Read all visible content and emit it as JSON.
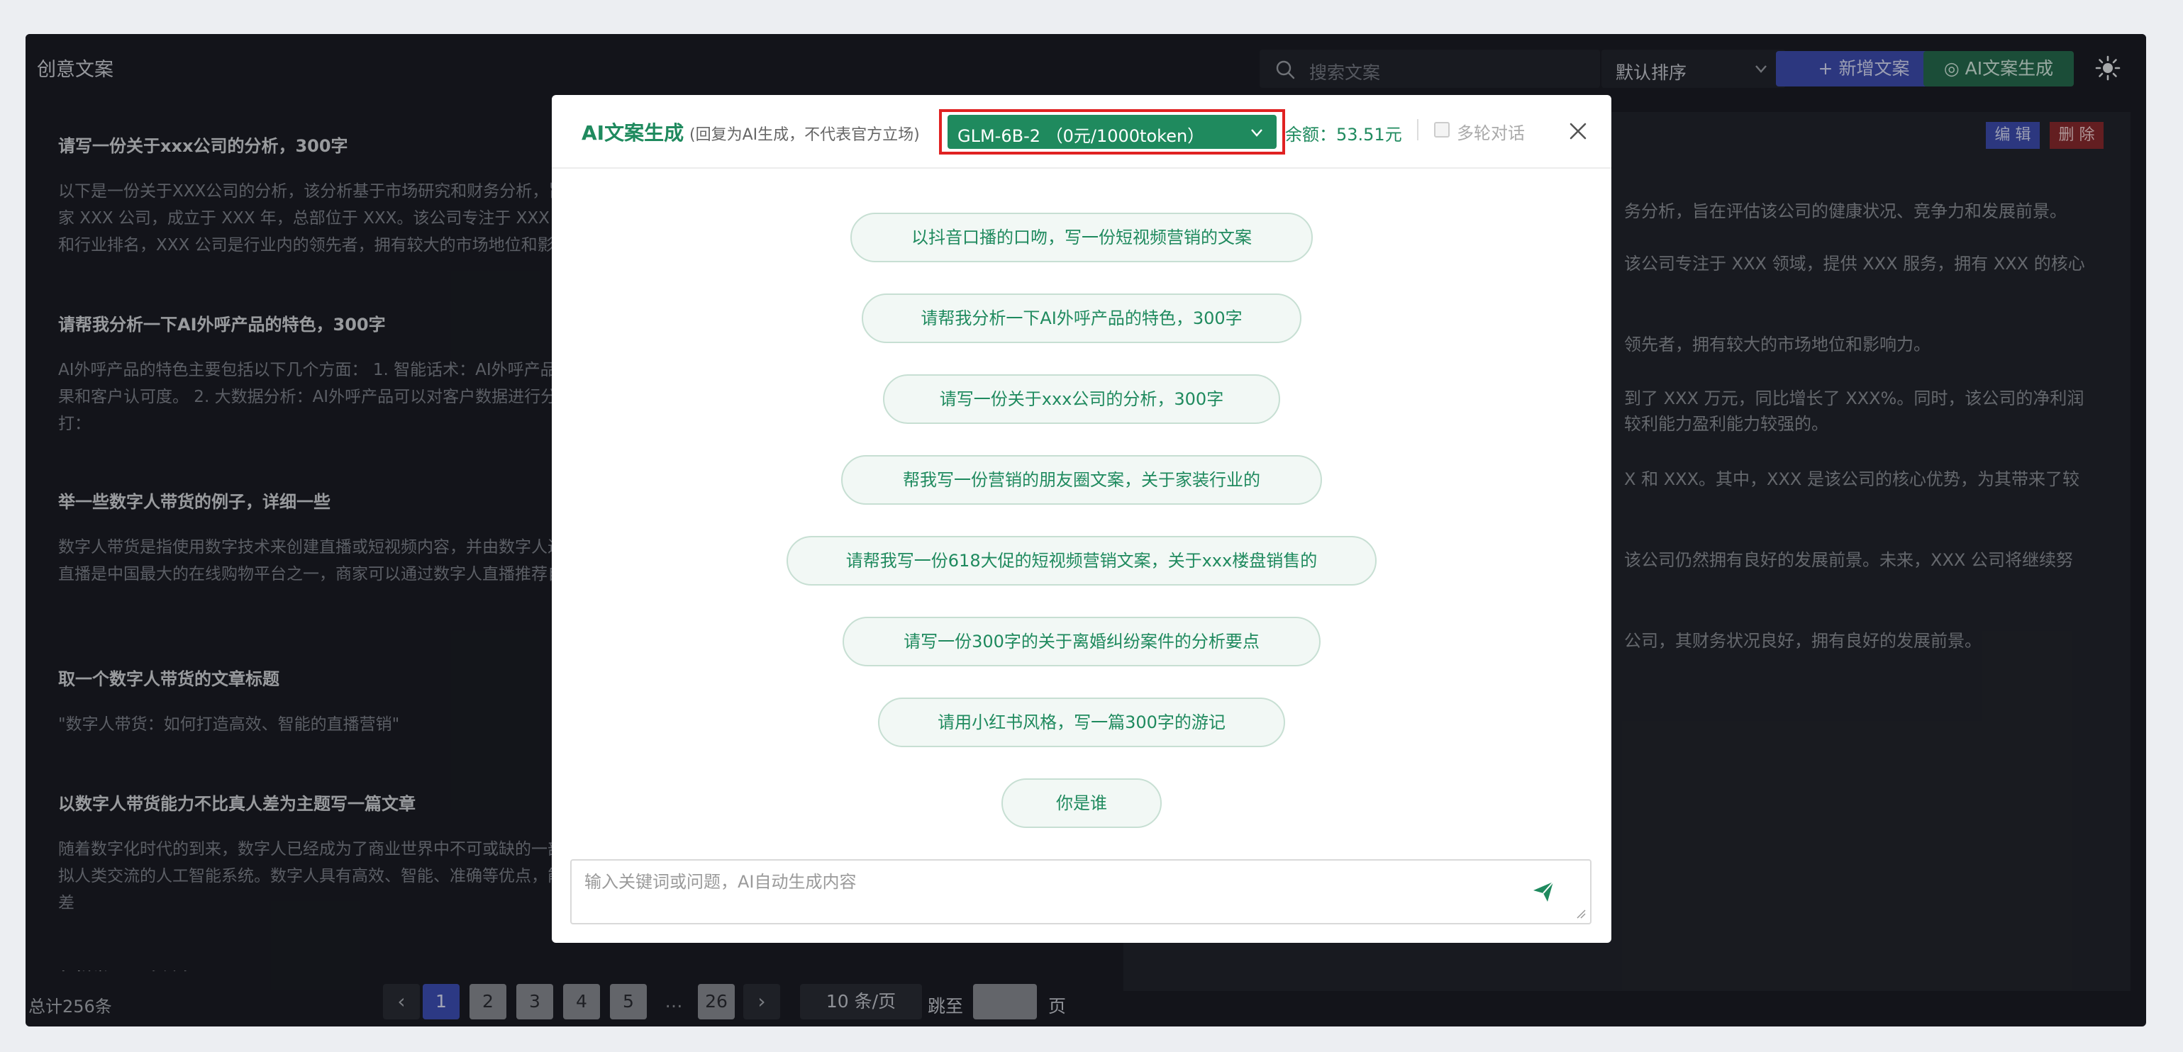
{
  "header": {
    "title": "创意文案",
    "search_placeholder": "搜索文案",
    "sort_label": "默认排序",
    "new_button": "+ 新增文案",
    "ai_button": "◎ AI文案生成"
  },
  "list": {
    "items": [
      {
        "title": "请写一份关于xxx公司的分析，300字",
        "desc": "以下是一份关于XXX公司的分析，该分析基于市场研究和财务分析，旨在评估该公司的健康状况、竞争力和发展前景。公司概况：XXX 公司是一家 XXX 公司，成立于 XXX 年，总部位于 XXX。该公司专注于 XXX 领域，提供 XXX 服务，拥有 XXX 的核心竞争力。 市场地位：根据市场份额和行业排名，XXX 公司是行业内的领先者，拥有较大的市场地位和影响力。"
      },
      {
        "title": "请帮我分析一下AI外呼产品的特色，300字",
        "desc": "AI外呼产品的特色主要包括以下几个方面： 1. 智能话术：AI外呼产品可以根据客户的需求和反馈，自动调整话术模板和提问方式，提高外呼的效果和客户认可度。 2. 大数据分析：AI外呼产品可以对客户数据进行分析，为客户提供个性化的推荐和营销，提高产品的销售转化率。 3. 自动拨打："
      },
      {
        "title": "举一些数字人带货的例子，详细一些",
        "desc": "数字人带货是指使用数字技术来创建直播或短视频内容，并由数字人进行商品推荐和销售的一种营销方式。以下是一些例子： 1. 淘宝直播：淘宝直播是中国最大的在线购物平台之一，商家可以通过数字人直播推荐自己的产品，同时也可以与其他品牌合作进行直播销售。 2. 京东"
      },
      {
        "title": "取一个数字人带货的文章标题",
        "desc": "\"数字人带货：如何打造高效、智能的直播营销\""
      },
      {
        "title": "以数字人带货能力不比真人差为主题写一篇文章",
        "desc": "随着数字化时代的到来，数字人已经成为了商业世界中不可或缺的一部分。数字人是一种基于人工智能和大数据技术，使用计算机程序和算法来模拟人类交流的人工智能系统。数字人具有高效、智能、准确等优点，能够降低人力成本，因此在商业活动中被广泛应用。 数字人带货能力不比真人差"
      },
      {
        "title": "怎样学习以降低血压",
        "desc": ""
      }
    ]
  },
  "detail": {
    "edit_label": "编 辑",
    "delete_label": "删 除",
    "paragraphs": [
      "务分析，旨在评估该公司的健康状况、竞争力和发展前景。",
      "该公司专注于 XXX 领域，提供 XXX 服务，拥有 XXX 的核心",
      "领先者，拥有较大的市场地位和影响力。",
      "到了 XXX 万元，同比增长了 XXX%。同时，该公司的净利润\n较利能力盈利能力较强的。",
      "X 和 XXX。其中，XXX 是该公司的核心优势，为其带来了较",
      "该公司仍然拥有良好的发展前景。未来，XXX 公司将继续努",
      "公司，其财务状况良好，拥有良好的发展前景。"
    ]
  },
  "pager": {
    "total": "总计256条",
    "pages": [
      "1",
      "2",
      "3",
      "4",
      "5"
    ],
    "ellipsis": "…",
    "last_page": "26",
    "current": "1",
    "prev": "‹",
    "next": "›",
    "per_page": "10 条/页",
    "goto_label": "跳至",
    "page_suffix": "页"
  },
  "modal": {
    "title": "AI文案生成",
    "note": "(回复为AI生成，不代表官方立场)",
    "model": "GLM-6B-2 （0元/1000token）",
    "balance": "余额：53.51元",
    "multi_turn": "多轮对话",
    "multi_turn_checked": false,
    "suggestions": [
      "以抖音口播的口吻，写一份短视频营销的文案",
      "请帮我分析一下AI外呼产品的特色，300字",
      "请写一份关于xxx公司的分析，300字",
      "帮我写一份营销的朋友圈文案，关于家装行业的",
      "请帮我写一份618大促的短视频营销文案，关于xxx楼盘销售的",
      "请写一份300字的关于离婚纠纷案件的分析要点",
      "请用小红书风格，写一篇300字的游记",
      "你是谁"
    ],
    "input_placeholder": "输入关键词或问题，AI自动生成内容"
  },
  "colors": {
    "accent_green": "#1f8a5e",
    "primary_blue": "#3e4fb8",
    "danger_red": "#8a2a2e",
    "highlight_outline": "#e02222"
  }
}
